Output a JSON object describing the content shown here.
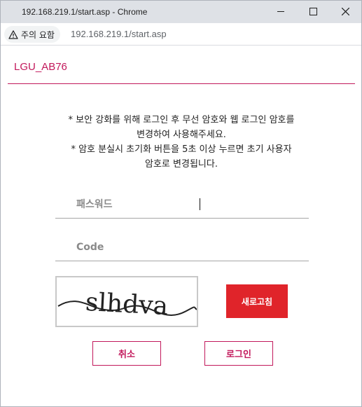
{
  "window": {
    "title": "192.168.219.1/start.asp - Chrome"
  },
  "addressbar": {
    "security_label": "주의 요함",
    "url": "192.168.219.1/start.asp"
  },
  "page": {
    "brand": "LGU_AB76",
    "notice_lines": [
      "* 보안 강화를 위해 로그인 후 무선 암호와 웹 로그인 암호를",
      "변경하여 사용해주세요.",
      "* 암호 분실시 초기화 버튼을 5초 이상 누르면 초기 사용자",
      "암호로 변경됩니다."
    ],
    "password_placeholder": "패스워드",
    "code_placeholder": "Code",
    "captcha_text": "slhdva",
    "refresh_label": "새로고침",
    "cancel_label": "취소",
    "login_label": "로그인"
  },
  "colors": {
    "accent": "#c2185b",
    "refresh_bg": "#e0242a",
    "titlebar_bg": "#dee1e6"
  }
}
